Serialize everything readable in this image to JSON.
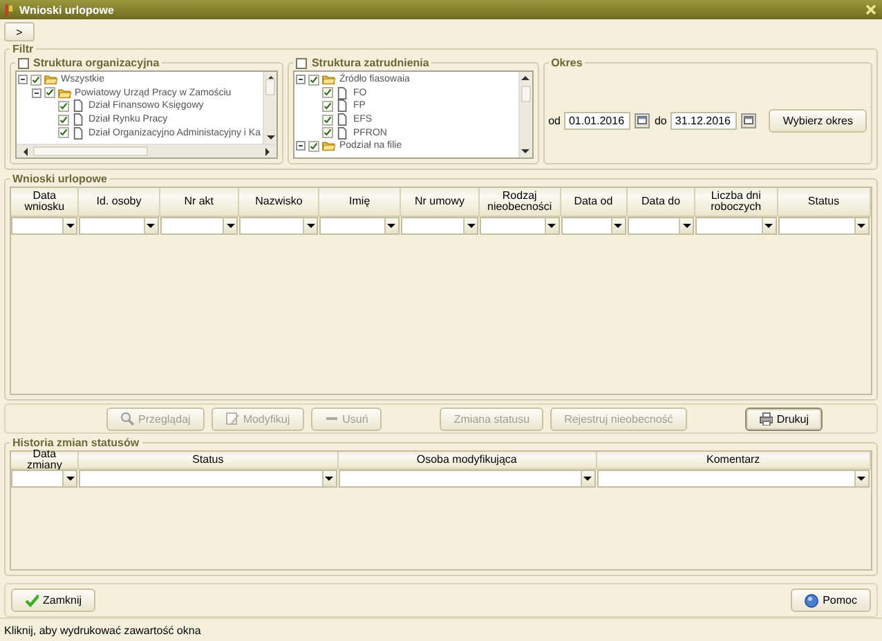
{
  "window": {
    "title": "Wnioski urlopowe"
  },
  "toolbar": {
    "toggle": ">"
  },
  "filter": {
    "title": "Filtr",
    "org": {
      "title": "Struktura organizacyjna",
      "checked": false,
      "tree": [
        {
          "label": "Wszystkie",
          "kind": "folder",
          "checked": true,
          "expanded": true,
          "children": [
            {
              "label": "Powiatowy Urząd Pracy w Zamościu",
              "kind": "folder",
              "checked": true,
              "expanded": true,
              "children": [
                {
                  "label": "Dział Finansowo Księgowy",
                  "kind": "file",
                  "checked": true
                },
                {
                  "label": "Dział Rynku Pracy",
                  "kind": "file",
                  "checked": true
                },
                {
                  "label": "Dział Organizacyjno Administacyjny i Ka",
                  "kind": "file",
                  "checked": true
                }
              ]
            }
          ]
        }
      ]
    },
    "emp": {
      "title": "Struktura zatrudnienia",
      "checked": false,
      "tree": [
        {
          "label": "Źródło fiasowaia",
          "kind": "folder",
          "checked": true,
          "expanded": true,
          "children": [
            {
              "label": "FO",
              "kind": "file",
              "checked": true
            },
            {
              "label": "FP",
              "kind": "file",
              "checked": true
            },
            {
              "label": "EFS",
              "kind": "file",
              "checked": true
            },
            {
              "label": "PFRON",
              "kind": "file",
              "checked": true
            }
          ]
        },
        {
          "label": "Podział na filie",
          "kind": "folder",
          "checked": true,
          "expanded": true
        }
      ]
    },
    "period": {
      "title": "Okres",
      "from_label": "od",
      "from": "01.01.2016",
      "to_label": "do",
      "to": "31.12.2016",
      "button": "Wybierz okres"
    }
  },
  "requests": {
    "title": "Wnioski urlopowe",
    "columns": [
      "Data wniosku",
      "Id. osoby",
      "Nr akt",
      "Nazwisko",
      "Imię",
      "Nr umowy",
      "Rodzaj nieobecności",
      "Data od",
      "Data do",
      "Liczba dni roboczych",
      "Status"
    ]
  },
  "actions": [
    {
      "label": "Przeglądaj",
      "disabled": true
    },
    {
      "label": "Modyfikuj",
      "disabled": true
    },
    {
      "label": "Usuń",
      "disabled": true
    },
    {
      "label": "Zmiana statusu",
      "disabled": true
    },
    {
      "label": "Rejestruj nieobecność",
      "disabled": true
    },
    {
      "label": "Drukuj",
      "disabled": false
    }
  ],
  "history": {
    "title": "Historia zmian statusów",
    "columns": [
      "Data zmiany",
      "Status",
      "Osoba modyfikująca",
      "Komentarz"
    ]
  },
  "footer": {
    "close": "Zamknij",
    "help": "Pomoc"
  },
  "status_bar": "Kliknij, aby wydrukować zawartość okna"
}
